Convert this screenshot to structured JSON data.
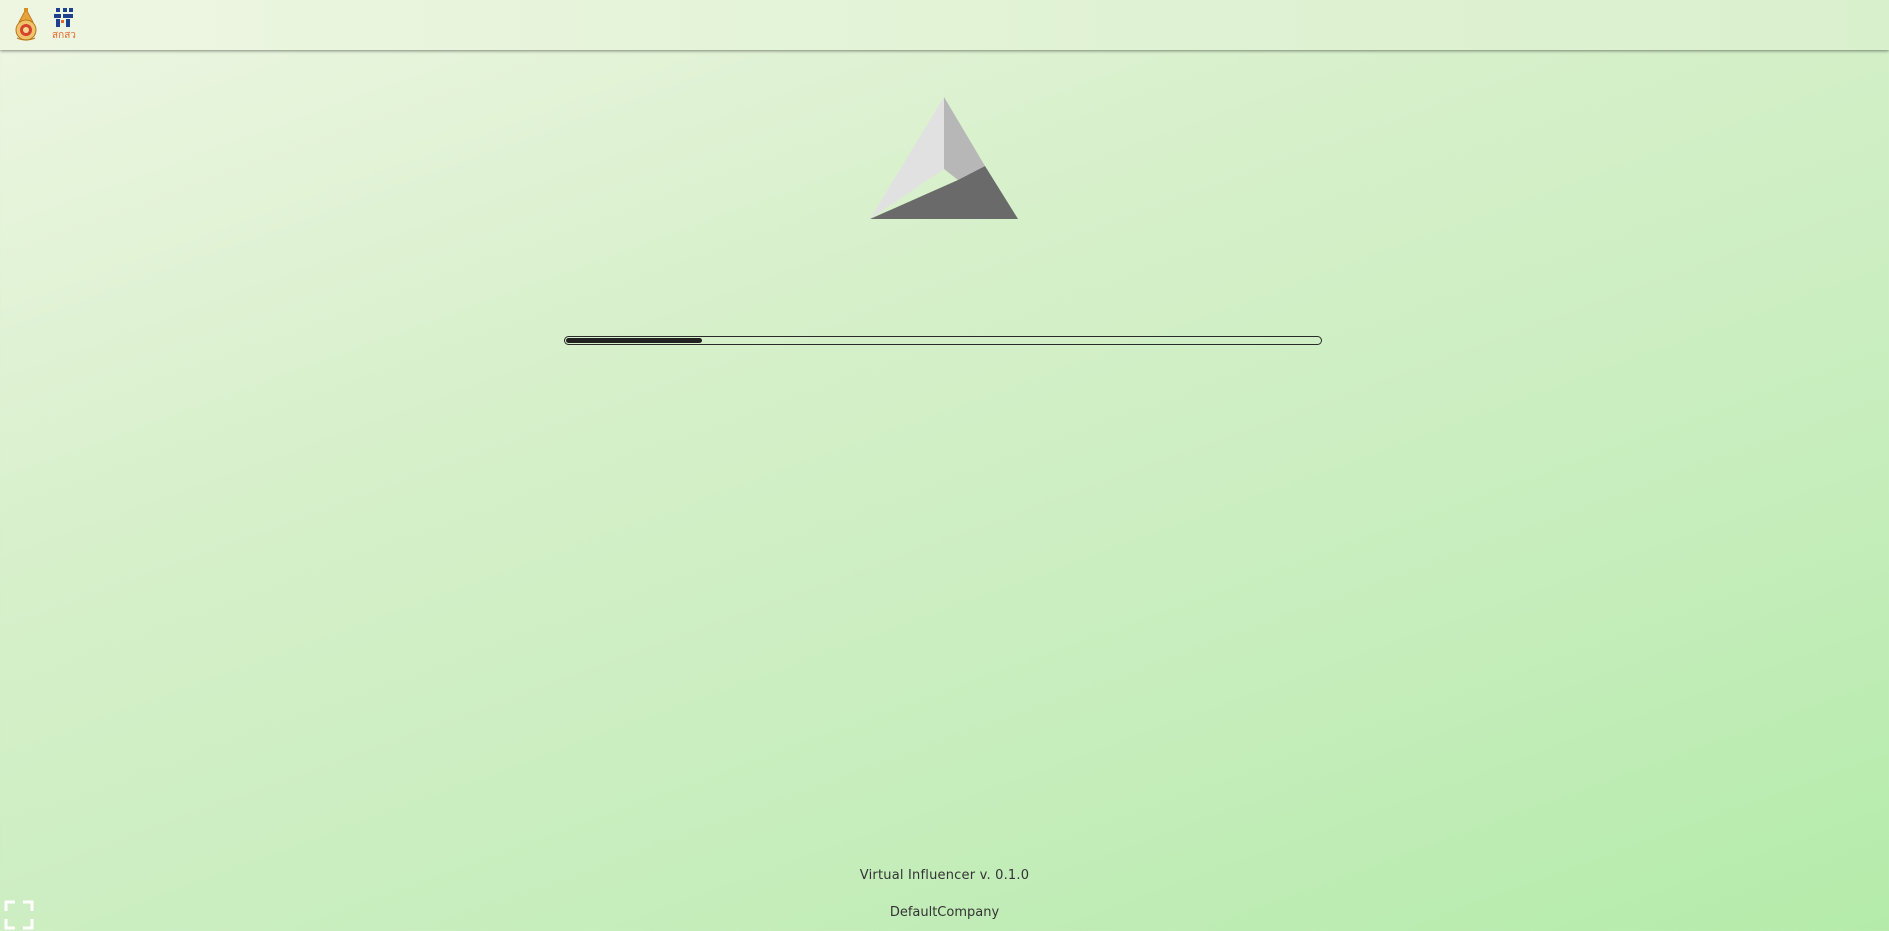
{
  "header": {
    "emblem_icon": "royal-emblem-icon",
    "brand_icon": "brand-logo-icon",
    "brand_caption": "สกสว"
  },
  "loader": {
    "logo_icon": "unity-logo-icon",
    "progress": 0.18
  },
  "footer": {
    "version": "Virtual Influencer v. 0.1.0",
    "company": "DefaultCompany"
  },
  "controls": {
    "fullscreen_icon": "fullscreen-icon"
  },
  "colors": {
    "bar_fill": "#222222",
    "bar_border": "#2a2a2a",
    "brand_orange": "#e36a2e",
    "brand_blue": "#1f3f8f"
  }
}
